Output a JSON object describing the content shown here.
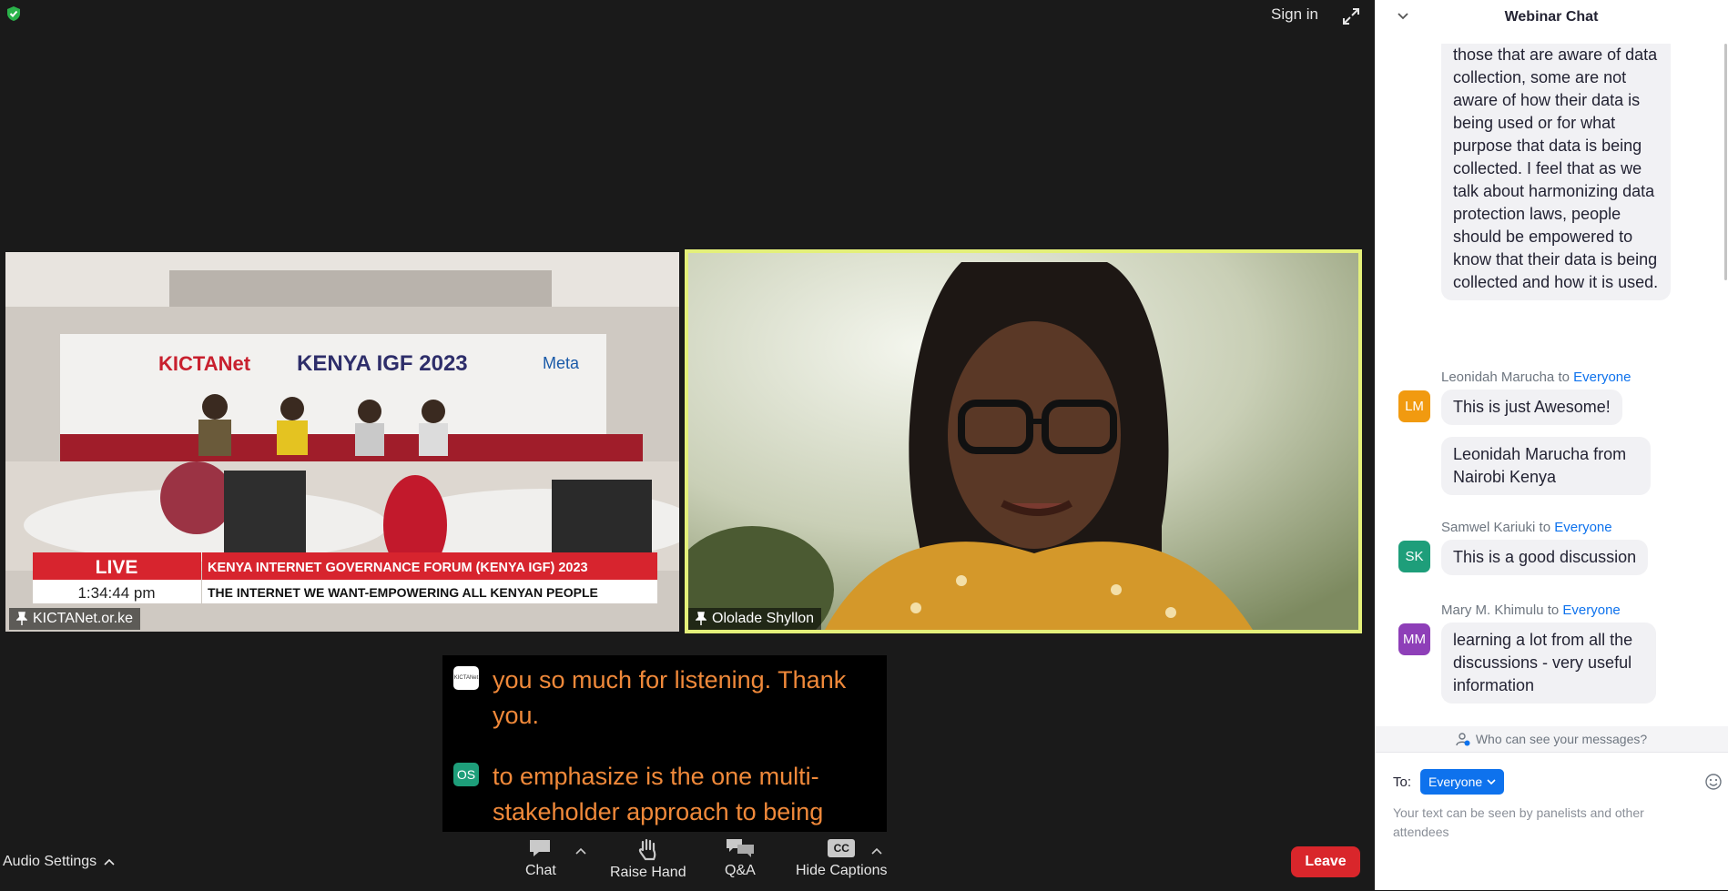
{
  "top": {
    "sign_in": "Sign in"
  },
  "videos": [
    {
      "name": "KICTANet.or.ke",
      "scene": {
        "logo": "KICTANet",
        "banner_title": "KENYA IGF 2023",
        "sponsor": "Meta",
        "live": "LIVE",
        "ticker_headline": "KENYA INTERNET GOVERNANCE FORUM (KENYA IGF) 2023",
        "ticker_time": "1:34:44 pm",
        "ticker_sub": "THE INTERNET WE WANT-EMPOWERING ALL KENYAN PEOPLE"
      }
    },
    {
      "name": "Ololade Shyllon",
      "active_speaker": true
    }
  ],
  "captions": [
    {
      "avatar": "KICTANet",
      "text": "you so much for listening. Thank you."
    },
    {
      "avatar": "OS",
      "text": "to emphasize is the one multi-stakeholder approach to being"
    }
  ],
  "toolbar": {
    "audio_settings": "Audio Settings",
    "chat": "Chat",
    "raise_hand": "Raise Hand",
    "qa": "Q&A",
    "hide_captions": "Hide Captions",
    "cc": "CC",
    "leave": "Leave"
  },
  "chat": {
    "title": "Webinar Chat",
    "to_word": "to",
    "messages": [
      {
        "text": "those that are aware of data collection, some are not aware of how their data is being used or for what purpose that data is being collected. I feel that as we talk about harmonizing data protection laws, people should be empowered to know that their data is being collected and how it is used."
      },
      {
        "sender": "Leonidah Marucha",
        "recipient": "Everyone",
        "initials": "LM",
        "color": "#f19a10",
        "texts": [
          "This is just Awesome!",
          "Leonidah Marucha from Nairobi Kenya"
        ]
      },
      {
        "sender": "Samwel Kariuki",
        "recipient": "Everyone",
        "initials": "SK",
        "color": "#1e9e7a",
        "texts": [
          "This is a good discussion"
        ]
      },
      {
        "sender": "Mary M. Khimulu",
        "recipient": "Everyone",
        "initials": "MM",
        "color": "#8e3fb8",
        "texts": [
          "learning a lot from all the discussions - very useful information"
        ]
      }
    ],
    "who_can_see": "Who can see your messages?",
    "to_label": "To:",
    "to_value": "Everyone",
    "placeholder": "Your text can be seen by panelists and other attendees"
  },
  "colors": {
    "active_speaker_border": "#e4f07a",
    "leave": "#d9262b",
    "accent": "#0e72ed",
    "caption_text": "#f0893a"
  },
  "icons": [
    "security-shield-icon",
    "expand-icon",
    "pin-icon",
    "chat-icon",
    "raise-hand-icon",
    "qa-icon",
    "cc-icon",
    "caret-up-icon",
    "chevron-down-icon",
    "user-info-icon",
    "emoji-icon"
  ]
}
